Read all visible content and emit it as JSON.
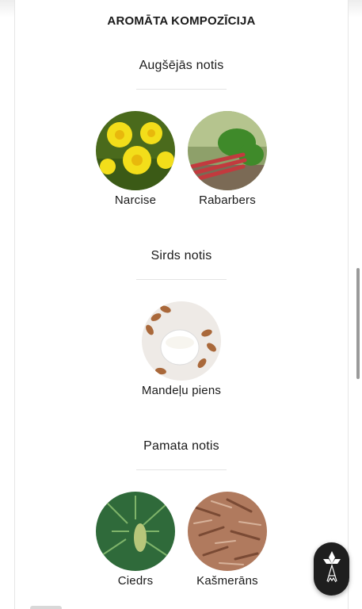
{
  "section_heading": "AROMĀTA KOMPOZĪCIJA",
  "groups": [
    {
      "title": "Augšējās notis",
      "notes": [
        {
          "label": "Narcise",
          "image": "daffodil-photo"
        },
        {
          "label": "Rabarbers",
          "image": "rhubarb-photo"
        }
      ]
    },
    {
      "title": "Sirds notis",
      "notes": [
        {
          "label": "Mandeļu piens",
          "image": "almond-milk-photo"
        }
      ]
    },
    {
      "title": "Pamata notis",
      "notes": [
        {
          "label": "Ciedrs",
          "image": "cedar-photo"
        },
        {
          "label": "Kašmerāns",
          "image": "cashmeran-wood-photo"
        }
      ]
    }
  ],
  "fab": {
    "icon": "brand-logo-icon"
  },
  "colors": {
    "fab_background": "#1e1e1e",
    "text": "#1a1a1a"
  }
}
